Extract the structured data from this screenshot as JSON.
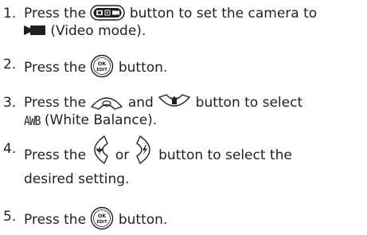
{
  "steps": [
    {
      "number": "1.",
      "line1_a": "Press the",
      "line1_b": "button to set the camera to",
      "line2": "(Video mode)."
    },
    {
      "number": "2.",
      "line1_a": "Press the",
      "line1_b": "button."
    },
    {
      "number": "3.",
      "line1_a": "Press the",
      "line1_b": "and",
      "line1_c": "button to select",
      "awb": "AWB",
      "line2": "(White Balance)."
    },
    {
      "number": "4.",
      "line1_a": "Press the",
      "line1_b": "or",
      "line1_c": "button to select the",
      "line2": "desired setting."
    },
    {
      "number": "5.",
      "line1_a": "Press the",
      "line1_b": "button."
    }
  ],
  "icons": {
    "mode_button": "mode-button-icon",
    "video_mode": "video-camera-icon",
    "ok_edit": "ok-edit-button-icon",
    "ok_edit_label_top": "OK",
    "ok_edit_label_bottom": "EDIT",
    "up_button": "up-arrow-button-icon",
    "down_button": "down-delete-button-icon",
    "left_button": "left-macro-button-icon",
    "right_button": "right-flash-button-icon"
  },
  "colors": {
    "text": "#231f20",
    "icon_fill": "#231f20",
    "background": "#ffffff"
  }
}
